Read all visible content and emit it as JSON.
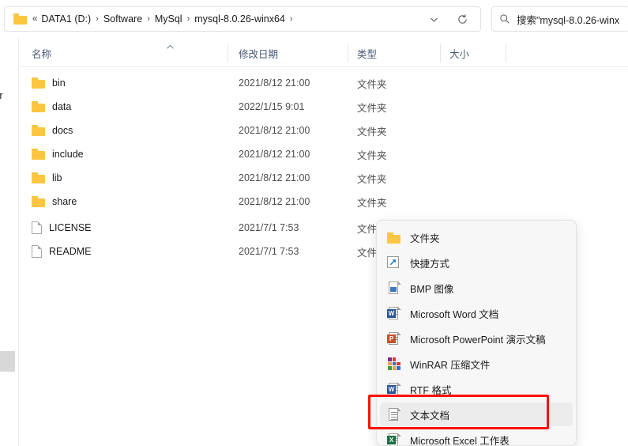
{
  "window": {
    "address_bar": {
      "folder_icon": "folder-icon",
      "overflow_chevrons": "«",
      "separator": "›",
      "crumbs": [
        "DATA1 (D:)",
        "Software",
        "MySql",
        "mysql-8.0.26-winx64"
      ],
      "dropdown_icon": "chevron-down-icon",
      "refresh_icon": "refresh-icon"
    },
    "search": {
      "icon": "search-icon",
      "value": "搜索\"mysql-8.0.26-winx"
    }
  },
  "nav_pane": {
    "clipped_item_label": "rsor",
    "scrollbar": "nav-scroll-thumb"
  },
  "columns": {
    "headers": [
      {
        "label": "名称",
        "sorted": true,
        "sort_icon": "caret-up-icon"
      },
      {
        "label": "修改日期",
        "sorted": false
      },
      {
        "label": "类型",
        "sorted": false
      },
      {
        "label": "大小",
        "sorted": false
      }
    ]
  },
  "files": [
    {
      "name": "bin",
      "icon": "folder-icon",
      "date": "2021/8/12 21:00",
      "type": "文件夹",
      "size": ""
    },
    {
      "name": "data",
      "icon": "folder-icon",
      "date": "2022/1/15 9:01",
      "type": "文件夹",
      "size": ""
    },
    {
      "name": "docs",
      "icon": "folder-icon",
      "date": "2021/8/12 21:00",
      "type": "文件夹",
      "size": ""
    },
    {
      "name": "include",
      "icon": "folder-icon",
      "date": "2021/8/12 21:00",
      "type": "文件夹",
      "size": ""
    },
    {
      "name": "lib",
      "icon": "folder-icon",
      "date": "2021/8/12 21:00",
      "type": "文件夹",
      "size": ""
    },
    {
      "name": "share",
      "icon": "folder-icon",
      "date": "2021/8/12 21:00",
      "type": "文件夹",
      "size": ""
    },
    {
      "name": "LICENSE",
      "icon": "file-icon",
      "date": "2021/7/1 7:53",
      "type": "文件",
      "size": ""
    },
    {
      "name": "README",
      "icon": "file-icon",
      "date": "2021/7/1 7:53",
      "type": "文件",
      "size": ""
    }
  ],
  "context_menu": {
    "items": [
      {
        "label": "文件夹",
        "icon": "folder-icon",
        "hover": false
      },
      {
        "label": "快捷方式",
        "icon": "shortcut-icon",
        "hover": false
      },
      {
        "label": "BMP 图像",
        "icon": "bmp-image-icon",
        "hover": false
      },
      {
        "label": "Microsoft Word 文档",
        "icon": "word-icon",
        "hover": false
      },
      {
        "label": "Microsoft PowerPoint 演示文稿",
        "icon": "powerpoint-icon",
        "hover": false
      },
      {
        "label": "WinRAR 压缩文件",
        "icon": "winrar-icon",
        "hover": false
      },
      {
        "label": "RTF 格式",
        "icon": "rtf-icon",
        "hover": false
      },
      {
        "label": "文本文档",
        "icon": "text-document-icon",
        "hover": true
      },
      {
        "label": "Microsoft Excel 工作表",
        "icon": "excel-icon",
        "hover": false
      }
    ]
  },
  "annotation": {
    "color": "#ff1100",
    "target_label": "文本文档"
  }
}
